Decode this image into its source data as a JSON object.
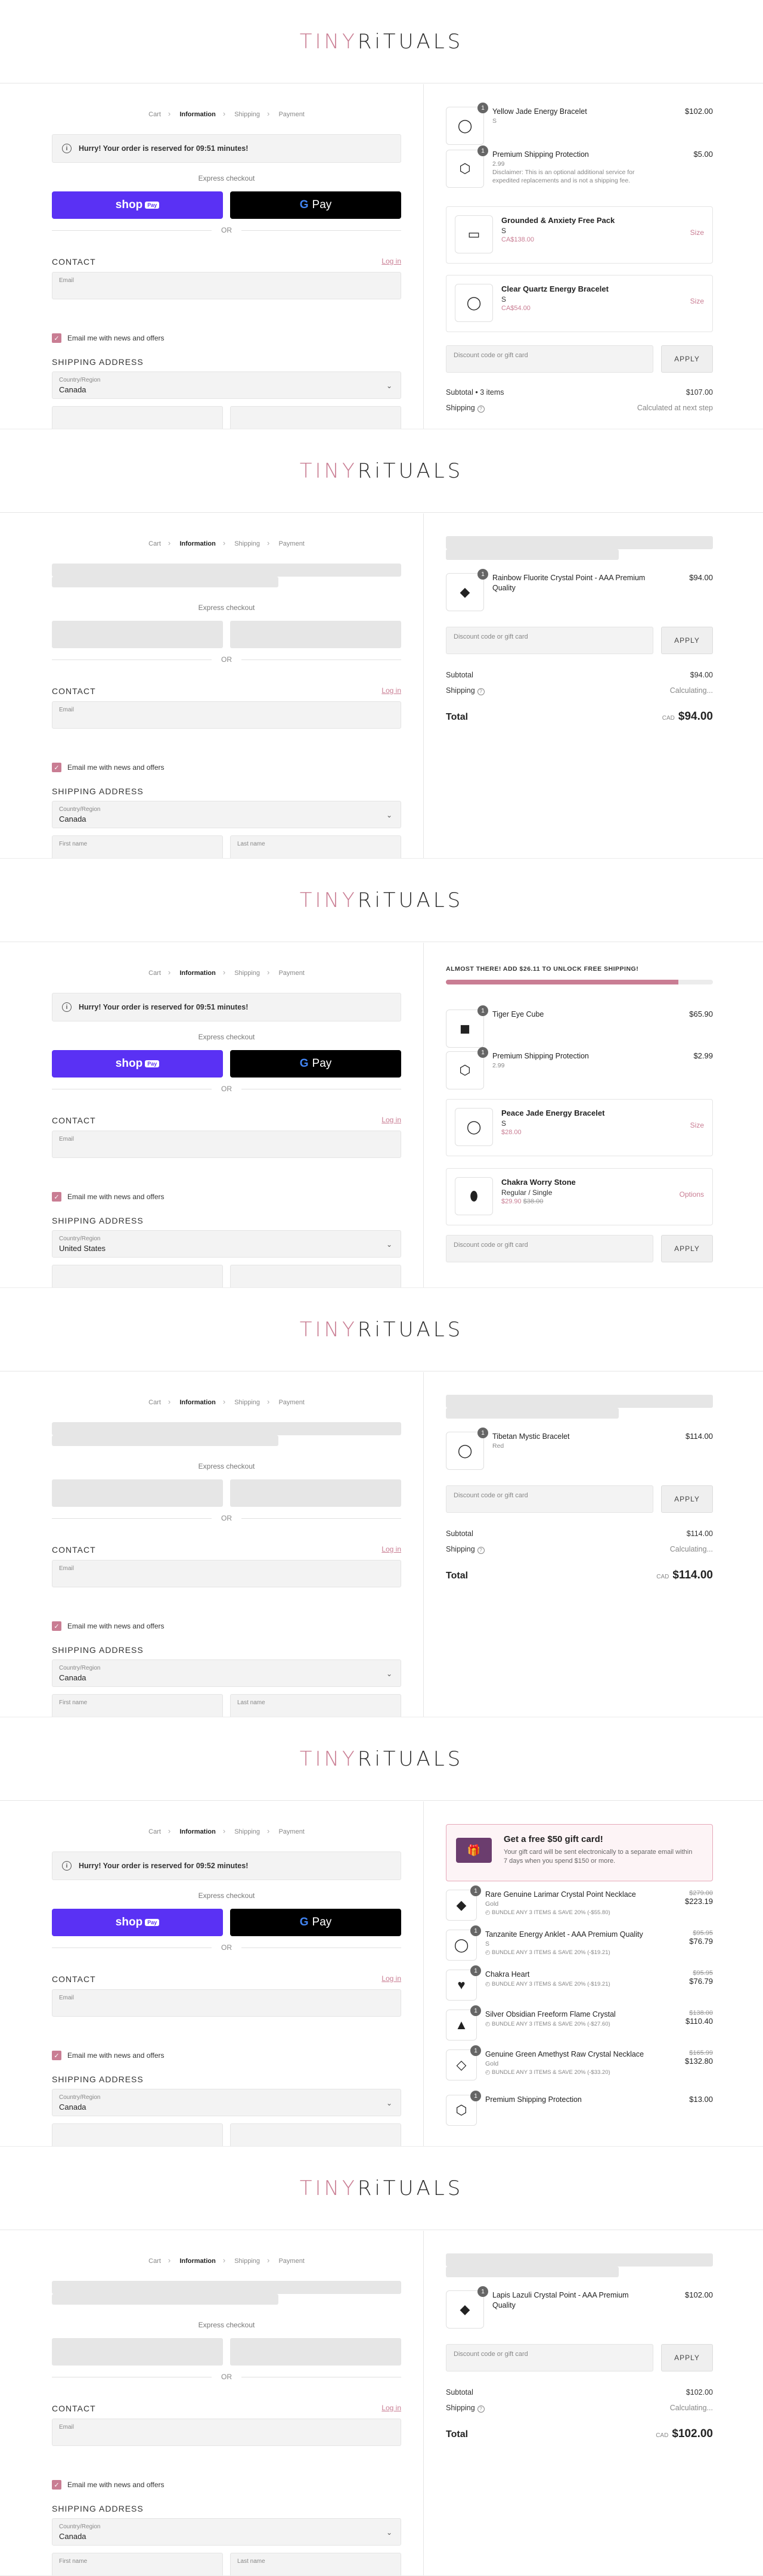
{
  "brand": {
    "logo_part1": "TINY",
    "logo_part2": "RiTUALS",
    "accent": "#c97d93"
  },
  "common": {
    "breadcrumbs": [
      "Cart",
      "Information",
      "Shipping",
      "Payment"
    ],
    "express_checkout": "Express checkout",
    "or": "OR",
    "shop_pay": "shop",
    "shop_pay_badge": "Pay",
    "gpay_g": "G",
    "gpay": "Pay",
    "contact": "CONTACT",
    "login": "Log in",
    "email_placeholder": "Email",
    "email_opt_in": "Email me with news and offers",
    "shipping_address": "SHIPPING ADDRESS",
    "country_label": "Country/Region",
    "first_name": "First name",
    "last_name": "Last name",
    "discount_placeholder": "Discount code or gift card",
    "apply": "APPLY",
    "subtotal": "Subtotal",
    "shipping": "Shipping",
    "total": "Total",
    "calculating": "Calculating..."
  },
  "panels": [
    {
      "reserve_prefix": "Hurry! Your order is reserved for ",
      "reserve_time": "09:51 minutes!",
      "country": "Canada",
      "items": [
        {
          "name": "Yellow Jade Energy Bracelet",
          "sub": "S",
          "price": "$102.00",
          "qty": "1",
          "icon": "bracelet-icon"
        },
        {
          "name": "Premium Shipping Protection",
          "sub": "2.99",
          "note": "Disclaimer: This is an optional additional service for expedited replacements and is not a shipping fee.",
          "price": "$5.00",
          "qty": "1",
          "icon": "box-icon"
        }
      ],
      "upsells": [
        {
          "name": "Grounded & Anxiety Free Pack",
          "variant": "S",
          "price": "CA$138.00",
          "button": "Size"
        },
        {
          "name": "Clear Quartz Energy Bracelet",
          "variant": "S",
          "price": "CA$54.00",
          "button": "Size"
        }
      ],
      "subtotal_label": "Subtotal • 3 items",
      "subtotal": "$107.00",
      "shipping": "Calculated at next step"
    },
    {
      "country": "Canada",
      "items": [
        {
          "name": "Rainbow Fluorite Crystal Point - AAA Premium Quality",
          "price": "$94.00",
          "qty": "1"
        }
      ],
      "subtotal": "$94.00",
      "currency": "CAD",
      "total": "$94.00"
    },
    {
      "reserve_prefix": "Hurry! Your order is reserved for ",
      "reserve_time": "09:51 minutes!",
      "country": "United States",
      "free_ship_text": "ALMOST THERE! ADD $26.11 TO UNLOCK FREE SHIPPING!",
      "free_ship_progress": 0.87,
      "items": [
        {
          "name": "Tiger Eye Cube",
          "price": "$65.90",
          "qty": "1"
        },
        {
          "name": "Premium Shipping Protection",
          "sub": "2.99",
          "price": "$2.99",
          "qty": "1"
        }
      ],
      "upsells": [
        {
          "name": "Peace Jade Energy Bracelet",
          "variant": "S",
          "price": "$28.00",
          "button": "Size"
        },
        {
          "name": "Chakra Worry Stone",
          "variant": "Regular / Single",
          "price": "$29.90",
          "old_price": "$38.00",
          "button": "Options"
        }
      ]
    },
    {
      "country": "Canada",
      "items": [
        {
          "name": "Tibetan Mystic Bracelet",
          "sub": "Red",
          "price": "$114.00",
          "qty": "1"
        }
      ],
      "subtotal": "$114.00",
      "currency": "CAD",
      "total": "$114.00"
    },
    {
      "reserve_prefix": "Hurry! Your order is reserved for ",
      "reserve_time": "09:52 minutes!",
      "country": "Canada",
      "gift_title": "Get a free $50 gift card!",
      "gift_desc": "Your gift card will be sent electronically to a separate email within 7 days when you spend $150 or more.",
      "items": [
        {
          "name": "Rare Genuine Larimar Crystal Point Necklace",
          "sub": "Gold",
          "bundle": "BUNDLE ANY 3 ITEMS & SAVE 20% (-$55.80)",
          "old_price": "$279.00",
          "price": "$223.19",
          "qty": "1"
        },
        {
          "name": "Tanzanite Energy Anklet - AAA Premium Quality",
          "sub": "S",
          "bundle": "BUNDLE ANY 3 ITEMS & SAVE 20% (-$19.21)",
          "old_price": "$95.95",
          "price": "$76.79",
          "qty": "1"
        },
        {
          "name": "Chakra Heart",
          "bundle": "BUNDLE ANY 3 ITEMS & SAVE 20% (-$19.21)",
          "old_price": "$95.95",
          "price": "$76.79",
          "qty": "1"
        },
        {
          "name": "Silver Obsidian Freeform Flame Crystal",
          "bundle": "BUNDLE ANY 3 ITEMS & SAVE 20% (-$27.60)",
          "old_price": "$138.00",
          "price": "$110.40",
          "qty": "1"
        },
        {
          "name": "Genuine Green Amethyst Raw Crystal Necklace",
          "sub": "Gold",
          "bundle": "BUNDLE ANY 3 ITEMS & SAVE 20% (-$33.20)",
          "old_price": "$165.99",
          "price": "$132.80",
          "qty": "1"
        },
        {
          "name": "Premium Shipping Protection",
          "price": "$13.00",
          "qty": "1"
        }
      ]
    },
    {
      "country": "Canada",
      "items": [
        {
          "name": "Lapis Lazuli Crystal Point - AAA Premium Quality",
          "price": "$102.00",
          "qty": "1"
        }
      ],
      "subtotal": "$102.00",
      "currency": "CAD",
      "total": "$102.00"
    }
  ]
}
